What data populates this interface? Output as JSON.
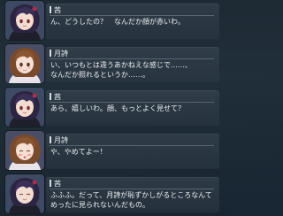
{
  "log": {
    "entries": [
      {
        "speaker": "茜",
        "character": "akane",
        "lines": [
          "ん、どうしたの？　なんだか顔が赤いわ。",
          ""
        ]
      },
      {
        "speaker": "月詩",
        "character": "tsukushi",
        "lines": [
          "い、いつもとは違うあかねえな感じで……、",
          "なんだか照れるというか……。"
        ]
      },
      {
        "speaker": "茜",
        "character": "akane",
        "lines": [
          "あら、嬉しいわ。顔、もっとよく見せて？",
          ""
        ]
      },
      {
        "speaker": "月詩",
        "character": "tsukushi",
        "lines": [
          "や、やめてよー！",
          ""
        ]
      },
      {
        "speaker": "茜",
        "character": "akane",
        "lines": [
          "ふふふ。だって、月詩が恥ずかしがるところなんて",
          "めったに見られないんだもの。"
        ]
      }
    ]
  }
}
